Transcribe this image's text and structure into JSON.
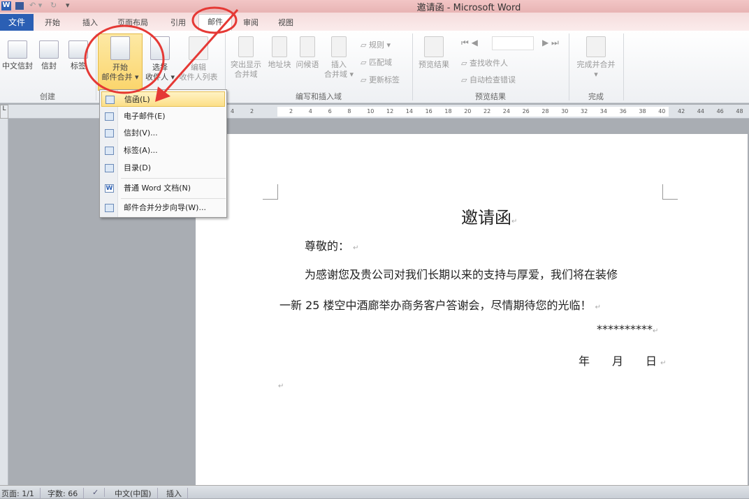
{
  "window": {
    "title": "邀请函 - Microsoft Word"
  },
  "tabs": [
    "文件",
    "开始",
    "插入",
    "页面布局",
    "引用",
    "邮件",
    "审阅",
    "视图"
  ],
  "ribbon": {
    "create": {
      "label": "创建",
      "buttons": [
        "中文信封",
        "信封",
        "标签"
      ]
    },
    "start": {
      "buttons": [
        {
          "l1": "开始",
          "l2": "邮件合并 ▾"
        },
        {
          "l1": "选择",
          "l2": "收件人 ▾"
        },
        {
          "l1": "编辑",
          "l2": "收件人列表"
        }
      ]
    },
    "write": {
      "label": "编写和插入域",
      "buttons": [
        {
          "l1": "突出显示",
          "l2": "合并域"
        },
        {
          "l1": "地址块",
          "l2": ""
        },
        {
          "l1": "问候语",
          "l2": ""
        },
        {
          "l1": "插入",
          "l2": "合并域 ▾"
        }
      ],
      "small": [
        "规则 ▾",
        "匹配域",
        "更新标签"
      ]
    },
    "preview": {
      "label": "预览结果",
      "button": "预览结果",
      "small": [
        "查找收件人",
        "自动检查错误"
      ]
    },
    "finish": {
      "label": "完成",
      "button": "完成并合并",
      "sub": "▾"
    }
  },
  "ruler": {
    "numbers": [
      "4",
      "2",
      "2",
      "4",
      "6",
      "8",
      "10",
      "12",
      "14",
      "16",
      "18",
      "20",
      "22",
      "24",
      "26",
      "28",
      "30",
      "32",
      "34",
      "36",
      "38",
      "40",
      "42",
      "44",
      "46",
      "48"
    ]
  },
  "menu": {
    "items": [
      "信函(L)",
      "电子邮件(E)",
      "信封(V)...",
      "标签(A)...",
      "目录(D)",
      "普通 Word 文档(N)",
      "邮件合并分步向导(W)..."
    ],
    "selected": 0
  },
  "document": {
    "title": "邀请函",
    "greeting": "尊敬的：",
    "body1": "为感谢您及贵公司对我们长期以来的支持与厚爱，我们将在装修",
    "body2": "一新 25 楼空中酒廊举办商务客户答谢会，尽情期待您的光临！",
    "signature": "**********",
    "date": "年　　月　　日",
    "mark": "↵"
  },
  "status": {
    "page": "页面: 1/1",
    "words": "字数: 66",
    "lang": "中文(中国)",
    "mode": "插入"
  },
  "colors": {
    "file_tab": "#2b5fb4",
    "highlight": "#fbd56c",
    "annotation": "#e53935"
  }
}
